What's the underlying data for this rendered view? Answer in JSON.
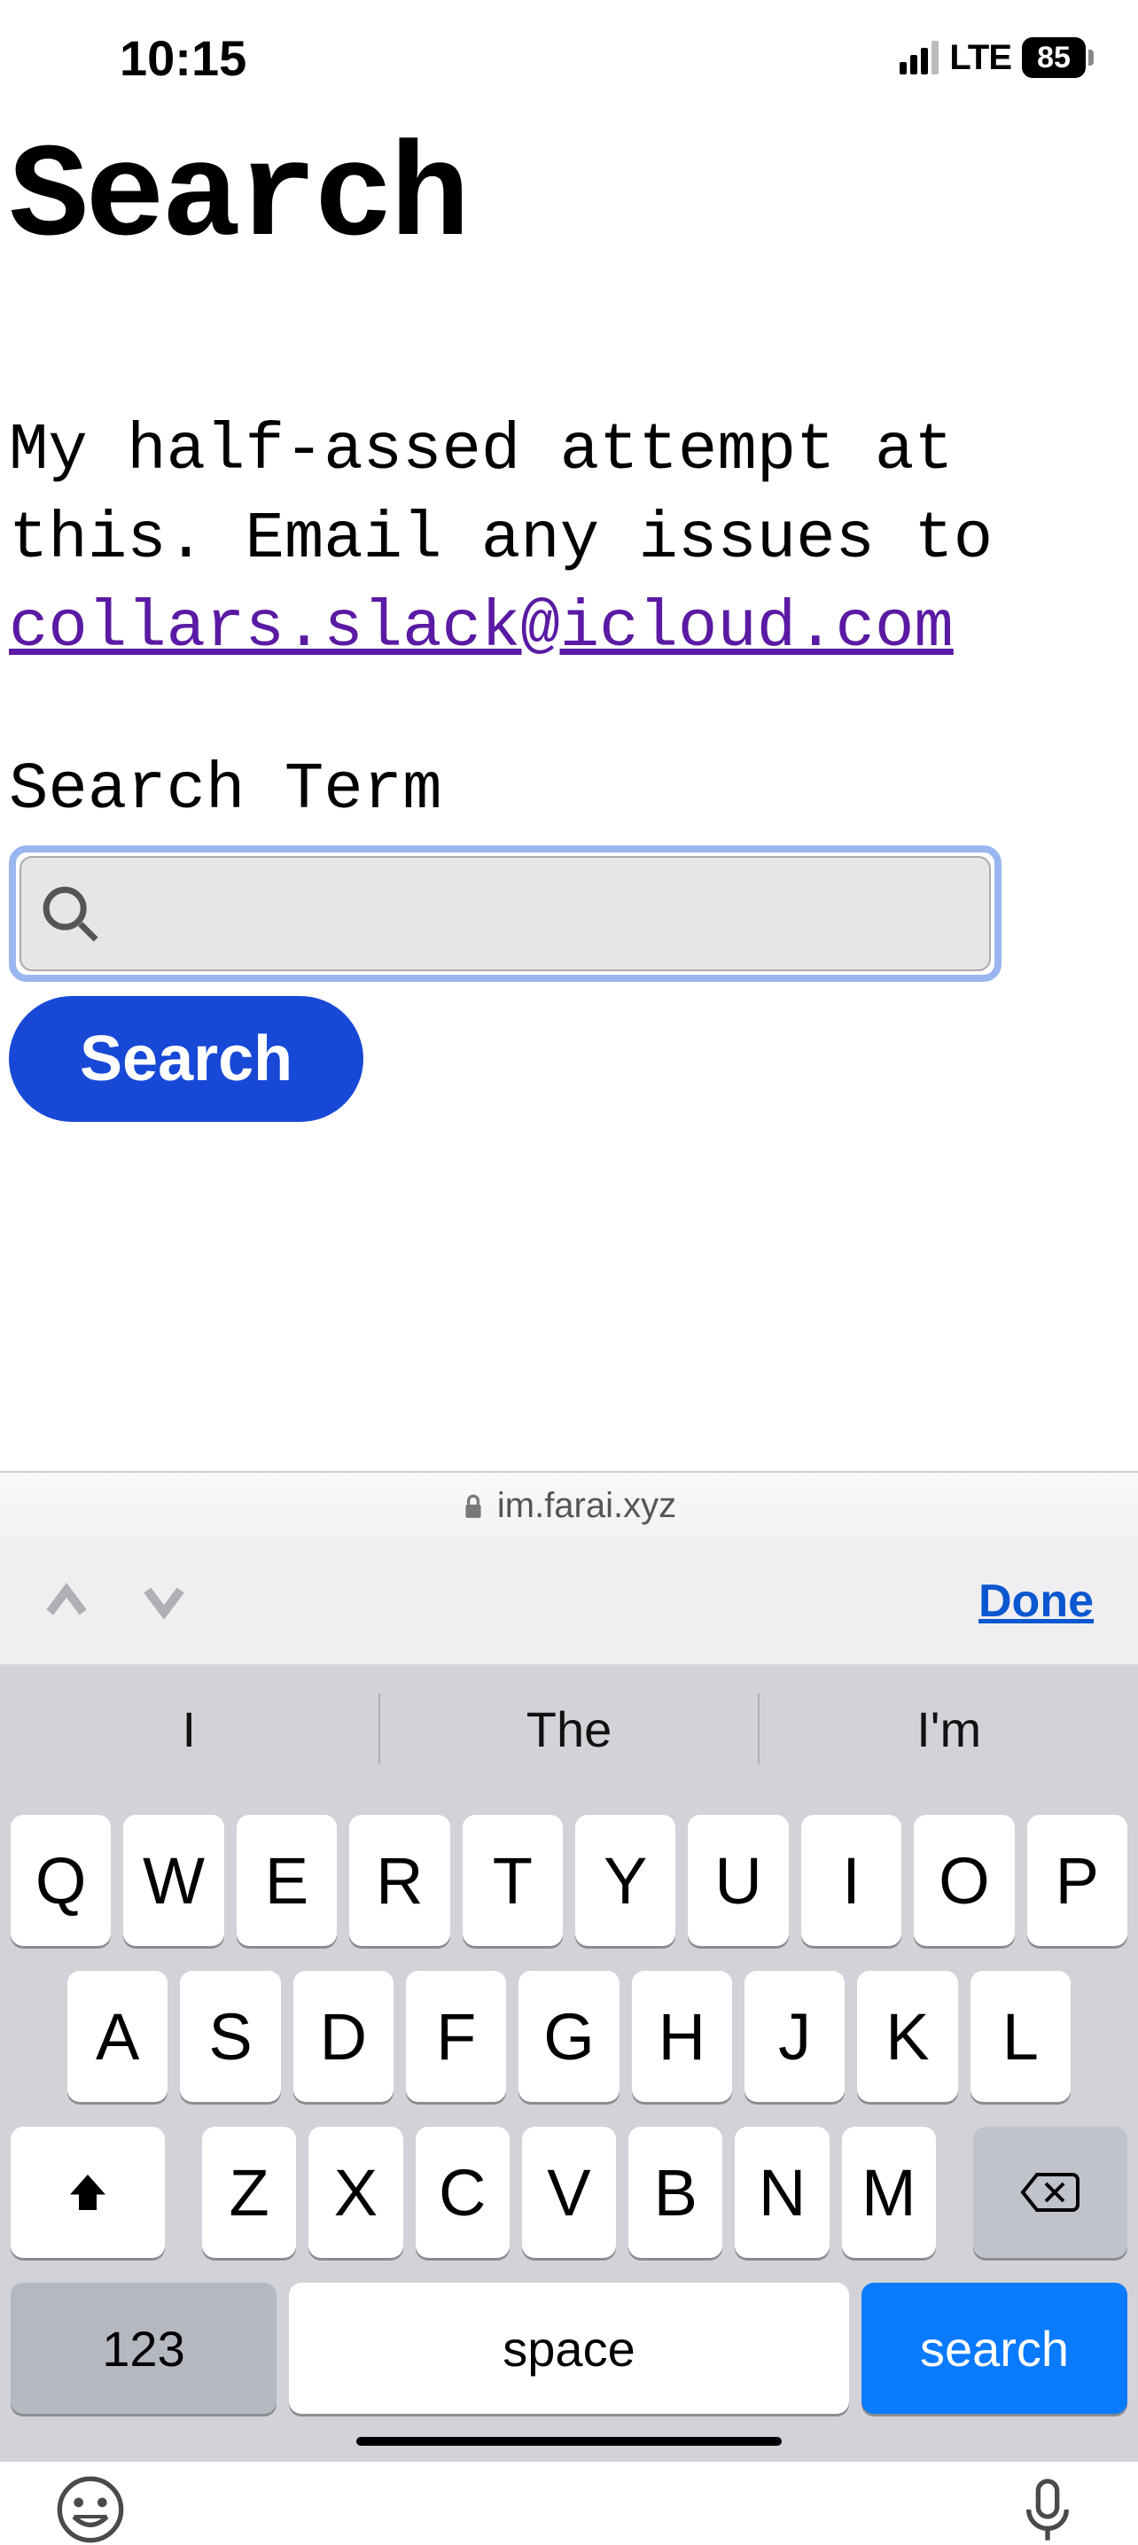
{
  "status": {
    "time": "10:15",
    "network": "LTE",
    "battery": "85"
  },
  "page": {
    "title": "Search",
    "intro_text": "My half-assed attempt at this. Email any issues to ",
    "email": "collars.slack@icloud.com",
    "search_label": "Search Term",
    "search_value": "",
    "search_button": "Search"
  },
  "browser": {
    "url": "im.farai.xyz"
  },
  "accessory": {
    "done": "Done"
  },
  "suggestions": [
    "I",
    "The",
    "I'm"
  ],
  "keyboard": {
    "row1": [
      "Q",
      "W",
      "E",
      "R",
      "T",
      "Y",
      "U",
      "I",
      "O",
      "P"
    ],
    "row2": [
      "A",
      "S",
      "D",
      "F",
      "G",
      "H",
      "J",
      "K",
      "L"
    ],
    "row3": [
      "Z",
      "X",
      "C",
      "V",
      "B",
      "N",
      "M"
    ],
    "numbers": "123",
    "space": "space",
    "action": "search"
  }
}
